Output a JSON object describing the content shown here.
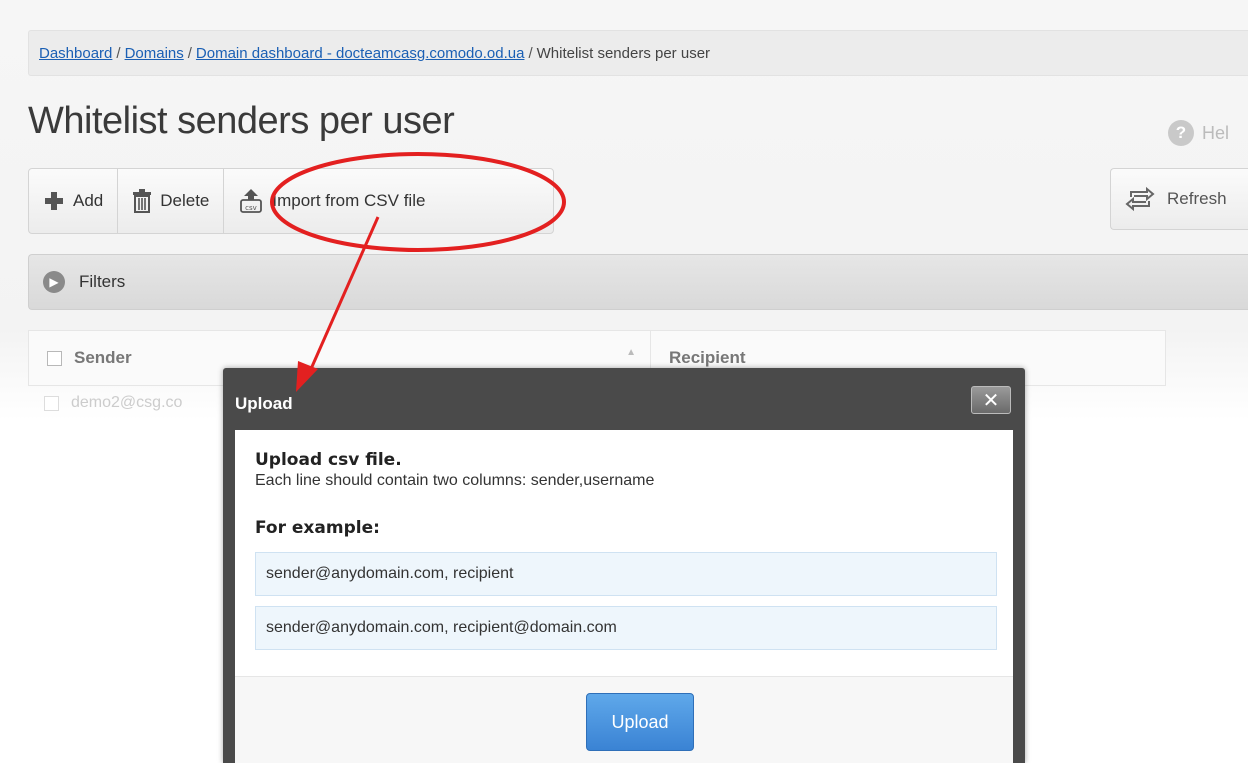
{
  "breadcrumb": {
    "items": [
      "Dashboard",
      "Domains",
      "Domain dashboard - docteamcasg.comodo.od.ua"
    ],
    "separator": "/",
    "current": "Whitelist senders per user"
  },
  "page_title": "Whitelist senders per user",
  "help": {
    "icon_text": "?",
    "label": "Hel"
  },
  "toolbar": {
    "add_label": "Add",
    "delete_label": "Delete",
    "import_label": "Import from CSV file",
    "csv_icon_text": "csv",
    "refresh_label": "Refresh"
  },
  "filters": {
    "label": "Filters"
  },
  "table": {
    "columns": [
      "Sender",
      "Recipient"
    ],
    "rows": [
      {
        "sender": "demo2@csg.co"
      }
    ]
  },
  "modal": {
    "title": "Upload",
    "close_symbol": "✕",
    "heading": "Upload csv file.",
    "description": "Each line should contain two columns: sender,username",
    "example_heading": "For example:",
    "examples": [
      "sender@anydomain.com, recipient",
      "sender@anydomain.com, recipient@domain.com"
    ],
    "upload_label": "Upload"
  },
  "colors": {
    "annotation_red": "#e32020",
    "primary_button": "#3f8ad8",
    "link": "#1a5fb4",
    "modal_frame": "#4a4a4a"
  }
}
